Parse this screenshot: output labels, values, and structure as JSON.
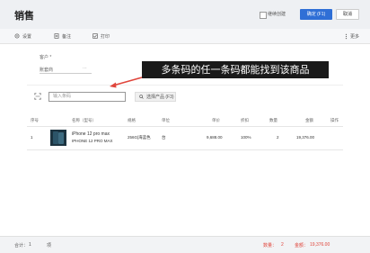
{
  "header": {
    "title": "销售",
    "checkbox_label": "继续创建",
    "ok_label": "确定 (F1)",
    "cancel_label": "取消"
  },
  "toolbar": {
    "settings": "设置",
    "remark": "备注",
    "print": "打印",
    "more": "更多"
  },
  "form": {
    "customer_label": "客户 *",
    "account_label": "账套商",
    "account_value": ""
  },
  "overlay_text": "多条码的任一条码都能找到该商品",
  "barcode": {
    "placeholder": "输入条码",
    "select_button": "选择产品 (F3)"
  },
  "table": {
    "columns": [
      "序号",
      "名称（型号）",
      "规格",
      "单位",
      "单价",
      "折扣",
      "数量",
      "金额",
      "操作"
    ],
    "rows": [
      {
        "index": "1",
        "name": "iPhone 12 pro max",
        "model": "IPHONE 12 PRO MAX",
        "spec": "256G|海蓝色",
        "unit": "台",
        "price": "9,688.00",
        "discount": "100%",
        "qty": "2",
        "amount": "19,376.00"
      }
    ]
  },
  "footer": {
    "total_label": "合计：",
    "total_count": "1",
    "total_unit": "项",
    "qty_label": "数量：",
    "qty_value": "2",
    "amount_label": "金额：",
    "amount_value": "19,376.00"
  },
  "colors": {
    "accent": "#2f6fd6",
    "overlay": "#1a1a1a",
    "footer_red": "#e0463c"
  }
}
